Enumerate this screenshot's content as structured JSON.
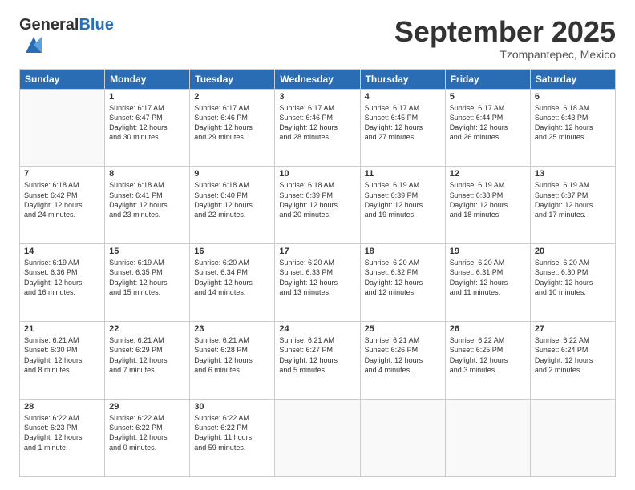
{
  "logo": {
    "general": "General",
    "blue": "Blue"
  },
  "header": {
    "month": "September 2025",
    "location": "Tzompantepec, Mexico"
  },
  "weekdays": [
    "Sunday",
    "Monday",
    "Tuesday",
    "Wednesday",
    "Thursday",
    "Friday",
    "Saturday"
  ],
  "weeks": [
    [
      {
        "day": "",
        "info": ""
      },
      {
        "day": "1",
        "info": "Sunrise: 6:17 AM\nSunset: 6:47 PM\nDaylight: 12 hours\nand 30 minutes."
      },
      {
        "day": "2",
        "info": "Sunrise: 6:17 AM\nSunset: 6:46 PM\nDaylight: 12 hours\nand 29 minutes."
      },
      {
        "day": "3",
        "info": "Sunrise: 6:17 AM\nSunset: 6:46 PM\nDaylight: 12 hours\nand 28 minutes."
      },
      {
        "day": "4",
        "info": "Sunrise: 6:17 AM\nSunset: 6:45 PM\nDaylight: 12 hours\nand 27 minutes."
      },
      {
        "day": "5",
        "info": "Sunrise: 6:17 AM\nSunset: 6:44 PM\nDaylight: 12 hours\nand 26 minutes."
      },
      {
        "day": "6",
        "info": "Sunrise: 6:18 AM\nSunset: 6:43 PM\nDaylight: 12 hours\nand 25 minutes."
      }
    ],
    [
      {
        "day": "7",
        "info": "Sunrise: 6:18 AM\nSunset: 6:42 PM\nDaylight: 12 hours\nand 24 minutes."
      },
      {
        "day": "8",
        "info": "Sunrise: 6:18 AM\nSunset: 6:41 PM\nDaylight: 12 hours\nand 23 minutes."
      },
      {
        "day": "9",
        "info": "Sunrise: 6:18 AM\nSunset: 6:40 PM\nDaylight: 12 hours\nand 22 minutes."
      },
      {
        "day": "10",
        "info": "Sunrise: 6:18 AM\nSunset: 6:39 PM\nDaylight: 12 hours\nand 20 minutes."
      },
      {
        "day": "11",
        "info": "Sunrise: 6:19 AM\nSunset: 6:39 PM\nDaylight: 12 hours\nand 19 minutes."
      },
      {
        "day": "12",
        "info": "Sunrise: 6:19 AM\nSunset: 6:38 PM\nDaylight: 12 hours\nand 18 minutes."
      },
      {
        "day": "13",
        "info": "Sunrise: 6:19 AM\nSunset: 6:37 PM\nDaylight: 12 hours\nand 17 minutes."
      }
    ],
    [
      {
        "day": "14",
        "info": "Sunrise: 6:19 AM\nSunset: 6:36 PM\nDaylight: 12 hours\nand 16 minutes."
      },
      {
        "day": "15",
        "info": "Sunrise: 6:19 AM\nSunset: 6:35 PM\nDaylight: 12 hours\nand 15 minutes."
      },
      {
        "day": "16",
        "info": "Sunrise: 6:20 AM\nSunset: 6:34 PM\nDaylight: 12 hours\nand 14 minutes."
      },
      {
        "day": "17",
        "info": "Sunrise: 6:20 AM\nSunset: 6:33 PM\nDaylight: 12 hours\nand 13 minutes."
      },
      {
        "day": "18",
        "info": "Sunrise: 6:20 AM\nSunset: 6:32 PM\nDaylight: 12 hours\nand 12 minutes."
      },
      {
        "day": "19",
        "info": "Sunrise: 6:20 AM\nSunset: 6:31 PM\nDaylight: 12 hours\nand 11 minutes."
      },
      {
        "day": "20",
        "info": "Sunrise: 6:20 AM\nSunset: 6:30 PM\nDaylight: 12 hours\nand 10 minutes."
      }
    ],
    [
      {
        "day": "21",
        "info": "Sunrise: 6:21 AM\nSunset: 6:30 PM\nDaylight: 12 hours\nand 8 minutes."
      },
      {
        "day": "22",
        "info": "Sunrise: 6:21 AM\nSunset: 6:29 PM\nDaylight: 12 hours\nand 7 minutes."
      },
      {
        "day": "23",
        "info": "Sunrise: 6:21 AM\nSunset: 6:28 PM\nDaylight: 12 hours\nand 6 minutes."
      },
      {
        "day": "24",
        "info": "Sunrise: 6:21 AM\nSunset: 6:27 PM\nDaylight: 12 hours\nand 5 minutes."
      },
      {
        "day": "25",
        "info": "Sunrise: 6:21 AM\nSunset: 6:26 PM\nDaylight: 12 hours\nand 4 minutes."
      },
      {
        "day": "26",
        "info": "Sunrise: 6:22 AM\nSunset: 6:25 PM\nDaylight: 12 hours\nand 3 minutes."
      },
      {
        "day": "27",
        "info": "Sunrise: 6:22 AM\nSunset: 6:24 PM\nDaylight: 12 hours\nand 2 minutes."
      }
    ],
    [
      {
        "day": "28",
        "info": "Sunrise: 6:22 AM\nSunset: 6:23 PM\nDaylight: 12 hours\nand 1 minute."
      },
      {
        "day": "29",
        "info": "Sunrise: 6:22 AM\nSunset: 6:22 PM\nDaylight: 12 hours\nand 0 minutes."
      },
      {
        "day": "30",
        "info": "Sunrise: 6:22 AM\nSunset: 6:22 PM\nDaylight: 11 hours\nand 59 minutes."
      },
      {
        "day": "",
        "info": ""
      },
      {
        "day": "",
        "info": ""
      },
      {
        "day": "",
        "info": ""
      },
      {
        "day": "",
        "info": ""
      }
    ]
  ]
}
